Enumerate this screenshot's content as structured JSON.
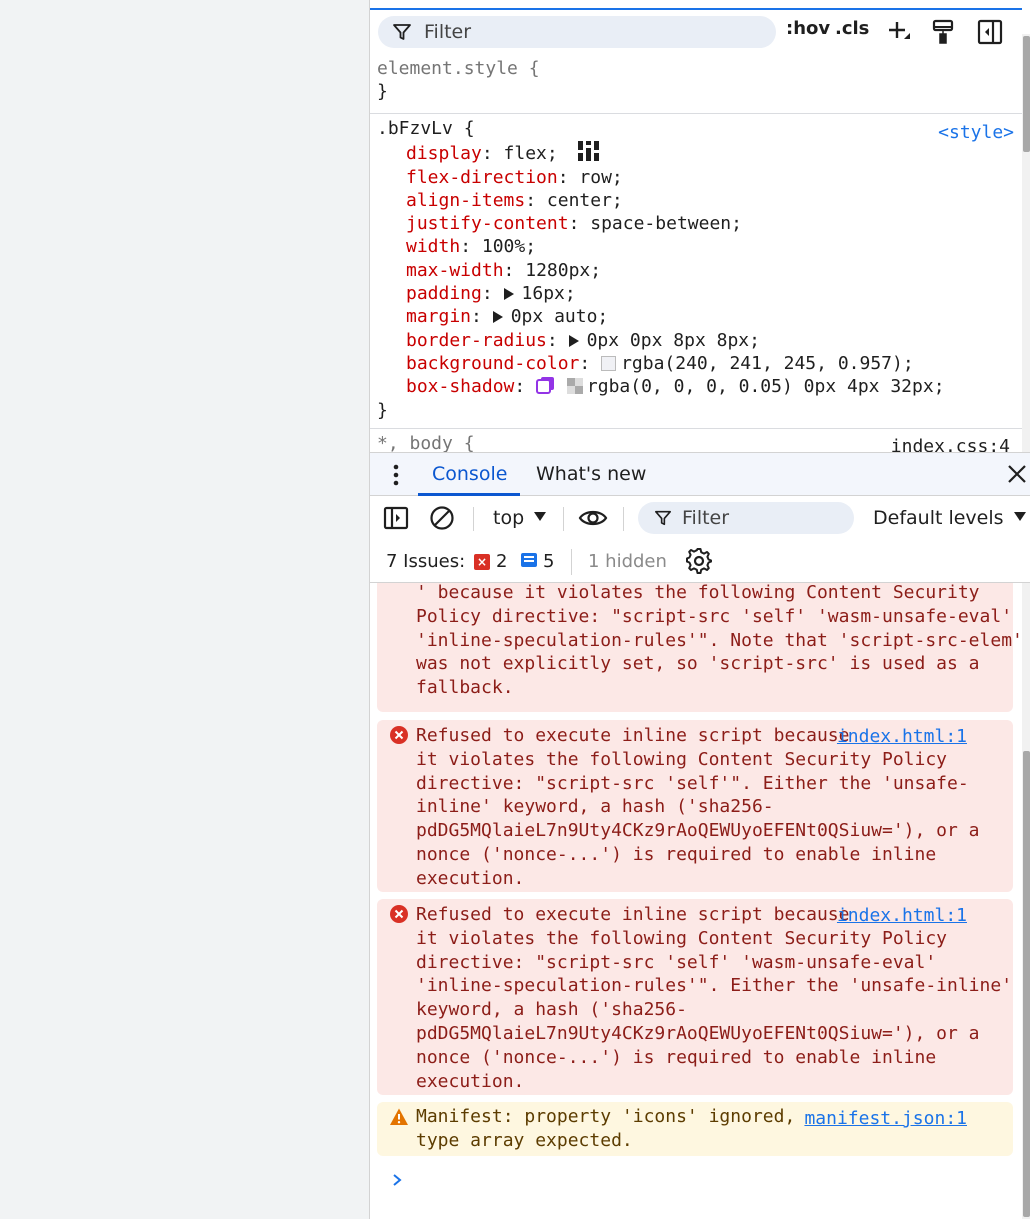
{
  "styles_toolbar": {
    "filter_placeholder": "Filter",
    "hov_label": ":hov",
    "cls_label": ".cls"
  },
  "rules": {
    "element_style": {
      "selector": "element.style {",
      "close": "}"
    },
    "main_rule": {
      "selector": ".bFzvLv {",
      "source": "<style>",
      "close": "}",
      "declarations": [
        {
          "prop": "display",
          "value": "flex;"
        },
        {
          "prop": "flex-direction",
          "value": "row;"
        },
        {
          "prop": "align-items",
          "value": "center;"
        },
        {
          "prop": "justify-content",
          "value": "space-between;"
        },
        {
          "prop": "width",
          "value": "100%;"
        },
        {
          "prop": "max-width",
          "value": "1280px;"
        },
        {
          "prop": "padding",
          "value": "16px;"
        },
        {
          "prop": "margin",
          "value": "0px auto;"
        },
        {
          "prop": "border-radius",
          "value": "0px 0px 8px 8px;"
        },
        {
          "prop": "background-color",
          "value": "rgba(240, 241, 245, 0.957);"
        },
        {
          "prop": "box-shadow",
          "value": "rgba(0, 0, 0, 0.05) 0px 4px 32px;"
        }
      ]
    },
    "next_rule": {
      "selector": "*, body {",
      "source": "index.css:4"
    }
  },
  "colors": {
    "background_swatch": "#f0f1f5",
    "shadow_swatch_accent": "#9334e6"
  },
  "drawer": {
    "tabs": [
      "Console",
      "What's new"
    ],
    "active_tab": "Console"
  },
  "console_toolbar": {
    "context": "top",
    "filter_placeholder": "Filter",
    "levels": "Default levels"
  },
  "issues": {
    "label": "7 Issues:",
    "errors": "2",
    "infos": "5",
    "hidden": "1 hidden"
  },
  "messages": [
    {
      "type": "error",
      "lines": [
        "' because it violates the following Content Security",
        "Policy directive: \"script-src 'self' 'wasm-unsafe-eval'",
        "'inline-speculation-rules'\". Note that 'script-src-elem'",
        "was not explicitly set, so 'script-src' is used as a",
        "fallback."
      ]
    },
    {
      "type": "error",
      "link": "index.html:1",
      "lines": [
        "Refused to execute inline script because",
        "it violates the following Content Security Policy",
        "directive: \"script-src 'self'\". Either the 'unsafe-",
        "inline' keyword, a hash ('sha256-",
        "pdDG5MQlaieL7n9Uty4CKz9rAoQEWUyoEFENt0QSiuw='), or a",
        "nonce ('nonce-...') is required to enable inline",
        "execution."
      ]
    },
    {
      "type": "error",
      "link": "index.html:1",
      "lines": [
        "Refused to execute inline script because",
        "it violates the following Content Security Policy",
        "directive: \"script-src 'self' 'wasm-unsafe-eval'",
        "'inline-speculation-rules'\". Either the 'unsafe-inline'",
        "keyword, a hash ('sha256-",
        "pdDG5MQlaieL7n9Uty4CKz9rAoQEWUyoEFENt0QSiuw='), or a",
        "nonce ('nonce-...') is required to enable inline",
        "execution."
      ]
    },
    {
      "type": "warning",
      "link": "manifest.json:1",
      "lines": [
        "Manifest: property 'icons' ignored,",
        "type array expected."
      ]
    }
  ]
}
